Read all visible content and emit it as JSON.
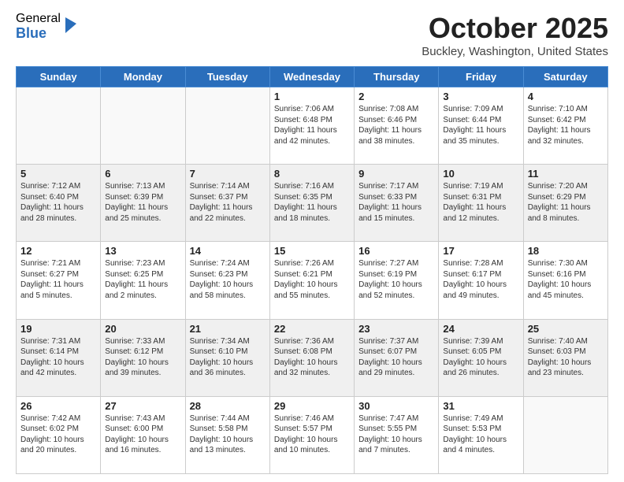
{
  "logo": {
    "general": "General",
    "blue": "Blue"
  },
  "header": {
    "month": "October 2025",
    "location": "Buckley, Washington, United States"
  },
  "days_of_week": [
    "Sunday",
    "Monday",
    "Tuesday",
    "Wednesday",
    "Thursday",
    "Friday",
    "Saturday"
  ],
  "weeks": [
    [
      {
        "day": "",
        "info": ""
      },
      {
        "day": "",
        "info": ""
      },
      {
        "day": "",
        "info": ""
      },
      {
        "day": "1",
        "info": "Sunrise: 7:06 AM\nSunset: 6:48 PM\nDaylight: 11 hours\nand 42 minutes."
      },
      {
        "day": "2",
        "info": "Sunrise: 7:08 AM\nSunset: 6:46 PM\nDaylight: 11 hours\nand 38 minutes."
      },
      {
        "day": "3",
        "info": "Sunrise: 7:09 AM\nSunset: 6:44 PM\nDaylight: 11 hours\nand 35 minutes."
      },
      {
        "day": "4",
        "info": "Sunrise: 7:10 AM\nSunset: 6:42 PM\nDaylight: 11 hours\nand 32 minutes."
      }
    ],
    [
      {
        "day": "5",
        "info": "Sunrise: 7:12 AM\nSunset: 6:40 PM\nDaylight: 11 hours\nand 28 minutes."
      },
      {
        "day": "6",
        "info": "Sunrise: 7:13 AM\nSunset: 6:39 PM\nDaylight: 11 hours\nand 25 minutes."
      },
      {
        "day": "7",
        "info": "Sunrise: 7:14 AM\nSunset: 6:37 PM\nDaylight: 11 hours\nand 22 minutes."
      },
      {
        "day": "8",
        "info": "Sunrise: 7:16 AM\nSunset: 6:35 PM\nDaylight: 11 hours\nand 18 minutes."
      },
      {
        "day": "9",
        "info": "Sunrise: 7:17 AM\nSunset: 6:33 PM\nDaylight: 11 hours\nand 15 minutes."
      },
      {
        "day": "10",
        "info": "Sunrise: 7:19 AM\nSunset: 6:31 PM\nDaylight: 11 hours\nand 12 minutes."
      },
      {
        "day": "11",
        "info": "Sunrise: 7:20 AM\nSunset: 6:29 PM\nDaylight: 11 hours\nand 8 minutes."
      }
    ],
    [
      {
        "day": "12",
        "info": "Sunrise: 7:21 AM\nSunset: 6:27 PM\nDaylight: 11 hours\nand 5 minutes."
      },
      {
        "day": "13",
        "info": "Sunrise: 7:23 AM\nSunset: 6:25 PM\nDaylight: 11 hours\nand 2 minutes."
      },
      {
        "day": "14",
        "info": "Sunrise: 7:24 AM\nSunset: 6:23 PM\nDaylight: 10 hours\nand 58 minutes."
      },
      {
        "day": "15",
        "info": "Sunrise: 7:26 AM\nSunset: 6:21 PM\nDaylight: 10 hours\nand 55 minutes."
      },
      {
        "day": "16",
        "info": "Sunrise: 7:27 AM\nSunset: 6:19 PM\nDaylight: 10 hours\nand 52 minutes."
      },
      {
        "day": "17",
        "info": "Sunrise: 7:28 AM\nSunset: 6:17 PM\nDaylight: 10 hours\nand 49 minutes."
      },
      {
        "day": "18",
        "info": "Sunrise: 7:30 AM\nSunset: 6:16 PM\nDaylight: 10 hours\nand 45 minutes."
      }
    ],
    [
      {
        "day": "19",
        "info": "Sunrise: 7:31 AM\nSunset: 6:14 PM\nDaylight: 10 hours\nand 42 minutes."
      },
      {
        "day": "20",
        "info": "Sunrise: 7:33 AM\nSunset: 6:12 PM\nDaylight: 10 hours\nand 39 minutes."
      },
      {
        "day": "21",
        "info": "Sunrise: 7:34 AM\nSunset: 6:10 PM\nDaylight: 10 hours\nand 36 minutes."
      },
      {
        "day": "22",
        "info": "Sunrise: 7:36 AM\nSunset: 6:08 PM\nDaylight: 10 hours\nand 32 minutes."
      },
      {
        "day": "23",
        "info": "Sunrise: 7:37 AM\nSunset: 6:07 PM\nDaylight: 10 hours\nand 29 minutes."
      },
      {
        "day": "24",
        "info": "Sunrise: 7:39 AM\nSunset: 6:05 PM\nDaylight: 10 hours\nand 26 minutes."
      },
      {
        "day": "25",
        "info": "Sunrise: 7:40 AM\nSunset: 6:03 PM\nDaylight: 10 hours\nand 23 minutes."
      }
    ],
    [
      {
        "day": "26",
        "info": "Sunrise: 7:42 AM\nSunset: 6:02 PM\nDaylight: 10 hours\nand 20 minutes."
      },
      {
        "day": "27",
        "info": "Sunrise: 7:43 AM\nSunset: 6:00 PM\nDaylight: 10 hours\nand 16 minutes."
      },
      {
        "day": "28",
        "info": "Sunrise: 7:44 AM\nSunset: 5:58 PM\nDaylight: 10 hours\nand 13 minutes."
      },
      {
        "day": "29",
        "info": "Sunrise: 7:46 AM\nSunset: 5:57 PM\nDaylight: 10 hours\nand 10 minutes."
      },
      {
        "day": "30",
        "info": "Sunrise: 7:47 AM\nSunset: 5:55 PM\nDaylight: 10 hours\nand 7 minutes."
      },
      {
        "day": "31",
        "info": "Sunrise: 7:49 AM\nSunset: 5:53 PM\nDaylight: 10 hours\nand 4 minutes."
      },
      {
        "day": "",
        "info": ""
      }
    ]
  ]
}
